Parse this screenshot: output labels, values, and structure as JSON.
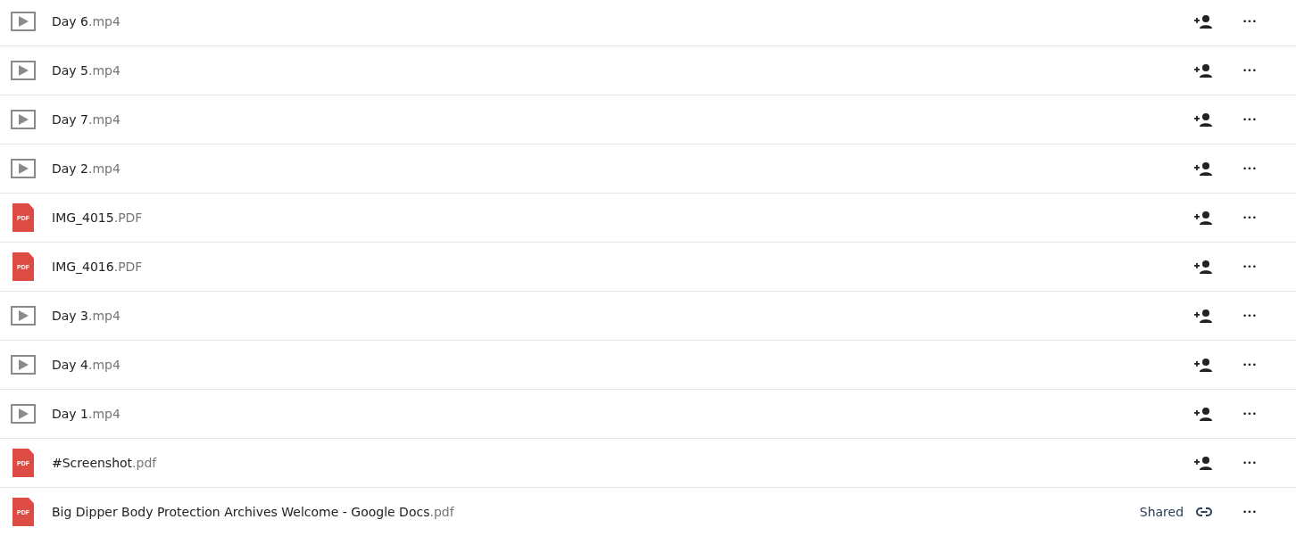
{
  "files": [
    {
      "icon": {
        "kind": "video"
      },
      "name": "Day 6",
      "extension": ".mp4",
      "share": {
        "kind": "add-person"
      },
      "menu": "•••"
    },
    {
      "icon": {
        "kind": "video"
      },
      "name": "Day 5",
      "extension": ".mp4",
      "share": {
        "kind": "add-person"
      },
      "menu": "•••"
    },
    {
      "icon": {
        "kind": "video"
      },
      "name": "Day 7",
      "extension": ".mp4",
      "share": {
        "kind": "add-person"
      },
      "menu": "•••"
    },
    {
      "icon": {
        "kind": "video"
      },
      "name": "Day 2",
      "extension": ".mp4",
      "share": {
        "kind": "add-person"
      },
      "menu": "•••"
    },
    {
      "icon": {
        "kind": "pdf",
        "label": "PDF"
      },
      "name": "IMG_4015",
      "extension": ".PDF",
      "share": {
        "kind": "add-person"
      },
      "menu": "•••"
    },
    {
      "icon": {
        "kind": "pdf",
        "label": "PDF"
      },
      "name": "IMG_4016",
      "extension": ".PDF",
      "share": {
        "kind": "add-person"
      },
      "menu": "•••"
    },
    {
      "icon": {
        "kind": "video"
      },
      "name": "Day 3",
      "extension": ".mp4",
      "share": {
        "kind": "add-person"
      },
      "menu": "•••"
    },
    {
      "icon": {
        "kind": "video"
      },
      "name": "Day 4",
      "extension": ".mp4",
      "share": {
        "kind": "add-person"
      },
      "menu": "•••"
    },
    {
      "icon": {
        "kind": "video"
      },
      "name": "Day 1",
      "extension": ".mp4",
      "share": {
        "kind": "add-person"
      },
      "menu": "•••"
    },
    {
      "icon": {
        "kind": "pdf",
        "label": "PDF"
      },
      "name": "#Screenshot",
      "extension": ".pdf",
      "share": {
        "kind": "add-person"
      },
      "menu": "•••"
    },
    {
      "icon": {
        "kind": "pdf",
        "label": "PDF"
      },
      "name": "Big Dipper Body Protection Archives Welcome - Google Docs",
      "extension": ".pdf",
      "share": {
        "kind": "link",
        "label": "Shared"
      },
      "menu": "•••"
    }
  ]
}
